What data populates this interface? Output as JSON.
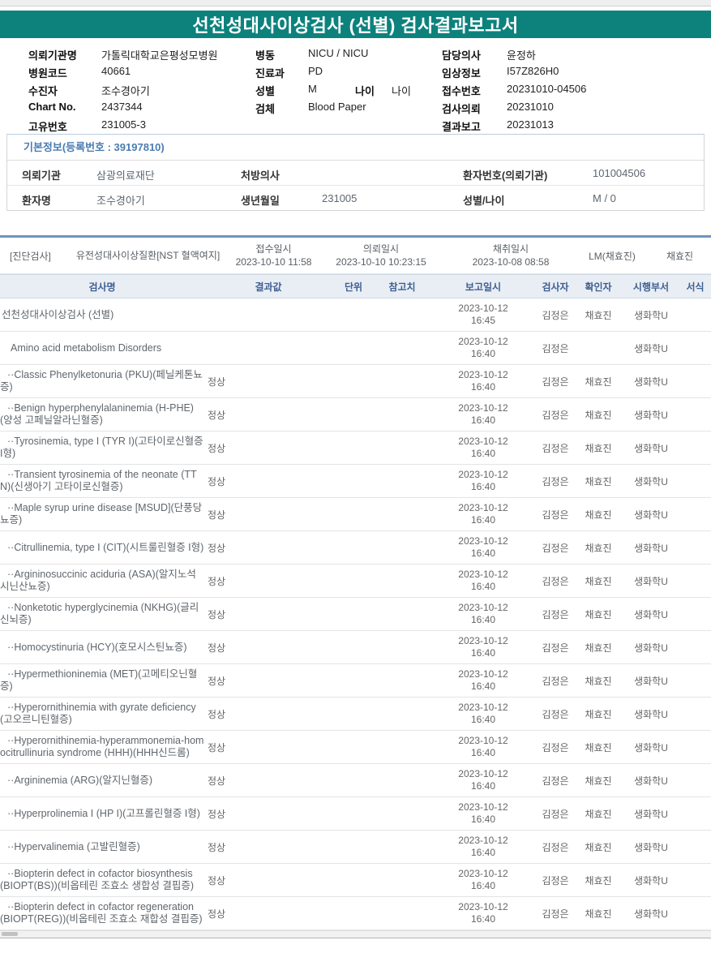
{
  "page": {
    "title": "선천성대사이상검사 (선별) 검사결과보고서"
  },
  "colors": {
    "teal_band": "#0d827d",
    "divider_blue": "#6e96bc",
    "table_header_bg": "#e9eef5",
    "table_header_text": "#3f5e92",
    "basic_title_blue": "#4a7cb0"
  },
  "info_grid": {
    "rows": [
      [
        {
          "label": "의뢰기관명",
          "value": "가톨릭대학교은평성모병원"
        },
        {
          "label": "병동",
          "value": "NICU / NICU"
        },
        {
          "label": "담당의사",
          "value": "윤정하"
        }
      ],
      [
        {
          "label": "병원코드",
          "value": "40661"
        },
        {
          "label": "진료과",
          "value": "PD"
        },
        {
          "label": "임상정보",
          "value": "I57Z826H0"
        }
      ],
      [
        {
          "label": "수진자",
          "value": "조수경아기"
        },
        {
          "label": "성별",
          "value": "M",
          "label2": "나이",
          "value2": "나이"
        },
        {
          "label": "접수번호",
          "value": "20231010-04506"
        }
      ],
      [
        {
          "label": "Chart No.",
          "value": "2437344"
        },
        {
          "label": "검체",
          "value": "Blood Paper"
        },
        {
          "label": "검사의뢰",
          "value": "20231010"
        }
      ],
      [
        {
          "label": "고유번호",
          "value": "231005-3"
        },
        null,
        {
          "label": "결과보고",
          "value": "20231013"
        }
      ]
    ]
  },
  "basic_info": {
    "title": "기본정보(등록번호 : 39197810)",
    "rows": [
      [
        {
          "label": "의뢰기관",
          "value": "삼광의료재단"
        },
        {
          "label": "처방의사",
          "value": ""
        },
        {
          "label": "환자번호(의뢰기관)",
          "value": "101004506"
        }
      ],
      [
        {
          "label": "환자명",
          "value": "조수경아기"
        },
        {
          "label": "생년월일",
          "value": "231005"
        },
        {
          "label": "성별/나이",
          "value": "M / 0"
        }
      ]
    ]
  },
  "diagnosis": {
    "section_label": "[진단검사]",
    "exam_name": "유전성대사이상질환[NST 혈액여지]",
    "times": [
      {
        "label": "접수일시",
        "value": "2023-10-10 11:58"
      },
      {
        "label": "의뢰일시",
        "value": "2023-10-10 10:23:15"
      },
      {
        "label": "채취일시",
        "value": "2023-10-08 08:58"
      }
    ],
    "collector": "LM(채효진)",
    "confirmer": "채효진"
  },
  "results_table": {
    "headers": [
      "검사명",
      "결과값",
      "단위",
      "참고치",
      "보고일시",
      "검사자",
      "확인자",
      "시행부서",
      "서식"
    ],
    "rows": [
      {
        "level": 0,
        "name": "선천성대사이상검사 (선별)",
        "result": "",
        "unit": "",
        "ref": "",
        "date": "2023-10-12",
        "time": "16:45",
        "tester": "김정은",
        "confirmer": "채효진",
        "dept": "생화학U",
        "format": ""
      },
      {
        "level": 1,
        "name": "Amino acid metabolism Disorders",
        "result": "",
        "unit": "",
        "ref": "",
        "date": "2023-10-12",
        "time": "16:40",
        "tester": "김정은",
        "confirmer": "",
        "dept": "생화학U",
        "format": ""
      },
      {
        "level": 2,
        "name": "··Classic Phenylketonuria (PKU)(페닐케톤뇨증)",
        "result": "정상",
        "unit": "",
        "ref": "",
        "date": "2023-10-12",
        "time": "16:40",
        "tester": "김정은",
        "confirmer": "채효진",
        "dept": "생화학U",
        "format": ""
      },
      {
        "level": 2,
        "name": "··Benign hyperphenylalaninemia (H-PHE)(양성 고페닐알라닌혈증)",
        "result": "정상",
        "unit": "",
        "ref": "",
        "date": "2023-10-12",
        "time": "16:40",
        "tester": "김정은",
        "confirmer": "채효진",
        "dept": "생화학U",
        "format": ""
      },
      {
        "level": 2,
        "name": "··Tyrosinemia, type I (TYR I)(고타이로신혈증 I형)",
        "result": "정상",
        "unit": "",
        "ref": "",
        "date": "2023-10-12",
        "time": "16:40",
        "tester": "김정은",
        "confirmer": "채효진",
        "dept": "생화학U",
        "format": ""
      },
      {
        "level": 2,
        "name": "··Transient tyrosinemia of the neonate (TTN)(신생아기 고타이로신혈증)",
        "result": "정상",
        "unit": "",
        "ref": "",
        "date": "2023-10-12",
        "time": "16:40",
        "tester": "김정은",
        "confirmer": "채효진",
        "dept": "생화학U",
        "format": ""
      },
      {
        "level": 2,
        "name": "··Maple syrup urine disease [MSUD](단풍당뇨증)",
        "result": "정상",
        "unit": "",
        "ref": "",
        "date": "2023-10-12",
        "time": "16:40",
        "tester": "김정은",
        "confirmer": "채효진",
        "dept": "생화학U",
        "format": ""
      },
      {
        "level": 2,
        "name": "··Citrullinemia, type I (CIT)(시트룰린혈증 I형)",
        "result": "정상",
        "unit": "",
        "ref": "",
        "date": "2023-10-12",
        "time": "16:40",
        "tester": "김정은",
        "confirmer": "채효진",
        "dept": "생화학U",
        "format": ""
      },
      {
        "level": 2,
        "name": "··Argininosuccinic aciduria (ASA)(알지노석시닌산뇨증)",
        "result": "정상",
        "unit": "",
        "ref": "",
        "date": "2023-10-12",
        "time": "16:40",
        "tester": "김정은",
        "confirmer": "채효진",
        "dept": "생화학U",
        "format": ""
      },
      {
        "level": 2,
        "name": "··Nonketotic hyperglycinemia (NKHG)(글리신뇌증)",
        "result": "정상",
        "unit": "",
        "ref": "",
        "date": "2023-10-12",
        "time": "16:40",
        "tester": "김정은",
        "confirmer": "채효진",
        "dept": "생화학U",
        "format": ""
      },
      {
        "level": 2,
        "name": "··Homocystinuria (HCY)(호모시스틴뇨증)",
        "result": "정상",
        "unit": "",
        "ref": "",
        "date": "2023-10-12",
        "time": "16:40",
        "tester": "김정은",
        "confirmer": "채효진",
        "dept": "생화학U",
        "format": ""
      },
      {
        "level": 2,
        "name": "··Hypermethioninemia (MET)(고메티오닌혈증)",
        "result": "정상",
        "unit": "",
        "ref": "",
        "date": "2023-10-12",
        "time": "16:40",
        "tester": "김정은",
        "confirmer": "채효진",
        "dept": "생화학U",
        "format": ""
      },
      {
        "level": 2,
        "name": "··Hyperornithinemia with gyrate deficiency(고오르니틴혈증)",
        "result": "정상",
        "unit": "",
        "ref": "",
        "date": "2023-10-12",
        "time": "16:40",
        "tester": "김정은",
        "confirmer": "채효진",
        "dept": "생화학U",
        "format": ""
      },
      {
        "level": 2,
        "name": "··Hyperornithinemia-hyperammonemia-homocitrullinuria syndrome (HHH)(HHH신드롬)",
        "result": "정상",
        "unit": "",
        "ref": "",
        "date": "2023-10-12",
        "time": "16:40",
        "tester": "김정은",
        "confirmer": "채효진",
        "dept": "생화학U",
        "format": ""
      },
      {
        "level": 2,
        "name": "··Argininemia (ARG)(알지닌혈증)",
        "result": "정상",
        "unit": "",
        "ref": "",
        "date": "2023-10-12",
        "time": "16:40",
        "tester": "김정은",
        "confirmer": "채효진",
        "dept": "생화학U",
        "format": ""
      },
      {
        "level": 2,
        "name": "··Hyperprolinemia I (HP I)(고프롤린혈증 I형)",
        "result": "정상",
        "unit": "",
        "ref": "",
        "date": "2023-10-12",
        "time": "16:40",
        "tester": "김정은",
        "confirmer": "채효진",
        "dept": "생화학U",
        "format": ""
      },
      {
        "level": 2,
        "name": "··Hypervalinemia (고발린혈증)",
        "result": "정상",
        "unit": "",
        "ref": "",
        "date": "2023-10-12",
        "time": "16:40",
        "tester": "김정은",
        "confirmer": "채효진",
        "dept": "생화학U",
        "format": ""
      },
      {
        "level": 2,
        "name": "··Biopterin defect in cofactor biosynthesis (BIOPT(BS))(비옵테린 조효소 생합성 결핍증)",
        "result": "정상",
        "unit": "",
        "ref": "",
        "date": "2023-10-12",
        "time": "16:40",
        "tester": "김정은",
        "confirmer": "채효진",
        "dept": "생화학U",
        "format": ""
      },
      {
        "level": 2,
        "name": "··Biopterin defect in cofactor regeneration (BIOPT(REG))(비옵테린 조효소 재합성 결핍증)",
        "result": "정상",
        "unit": "",
        "ref": "",
        "date": "2023-10-12",
        "time": "16:40",
        "tester": "김정은",
        "confirmer": "채효진",
        "dept": "생화학U",
        "format": ""
      }
    ]
  }
}
